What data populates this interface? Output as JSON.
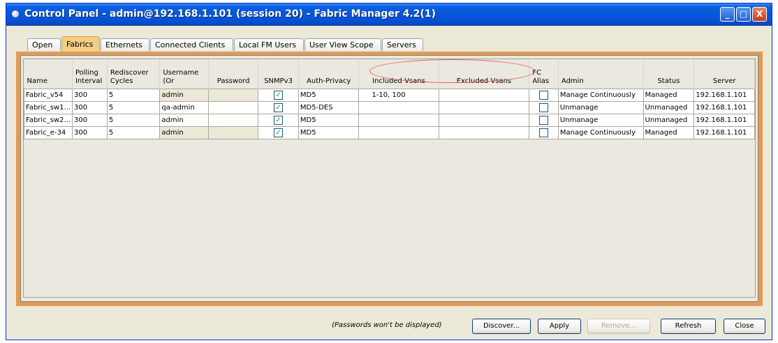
{
  "window": {
    "title": "Control Panel - admin@192.168.1.101 (session 20) - Fabric Manager 4.2(1)",
    "controls": {
      "minimize": "_",
      "maximize": "□",
      "close": "X"
    }
  },
  "tabs": [
    {
      "label": "Open",
      "active": false
    },
    {
      "label": "Fabrics",
      "active": true
    },
    {
      "label": "Ethernets",
      "active": false
    },
    {
      "label": "Connected Clients",
      "active": false
    },
    {
      "label": "Local FM Users",
      "active": false
    },
    {
      "label": "User View Scope",
      "active": false
    },
    {
      "label": "Servers",
      "active": false
    }
  ],
  "table": {
    "headers": [
      {
        "line1": "",
        "line2": "Name"
      },
      {
        "line1": "Polling",
        "line2": "Interval"
      },
      {
        "line1": "Rediscover",
        "line2": "Cycles"
      },
      {
        "line1": "Username",
        "line2": "(Or"
      },
      {
        "line1": "",
        "line2": "Password"
      },
      {
        "line1": "",
        "line2": "SNMPv3"
      },
      {
        "line1": "",
        "line2": "Auth-Privacy"
      },
      {
        "line1": "",
        "line2": "Included Vsans"
      },
      {
        "line1": "",
        "line2": "Excluded Vsans"
      },
      {
        "line1": "FC",
        "line2": "Alias"
      },
      {
        "line1": "",
        "line2": "Admin"
      },
      {
        "line1": "",
        "line2": "Status"
      },
      {
        "line1": "",
        "line2": "Server"
      }
    ],
    "rows": [
      {
        "name": "Fabric_v54",
        "polling": "300",
        "rediscover": "5",
        "username": "admin",
        "password": "",
        "snmpv3": true,
        "auth": "MD5",
        "included": "1-10, 100",
        "excluded": "",
        "fc_alias": false,
        "admin": "Manage Continuously",
        "status": "Managed",
        "server": "192.168.1.101"
      },
      {
        "name": "Fabric_sw1...",
        "polling": "300",
        "rediscover": "5",
        "username": "qa-admin",
        "password": "",
        "snmpv3": true,
        "auth": "MD5-DES",
        "included": "",
        "excluded": "",
        "fc_alias": false,
        "admin": "Unmanage",
        "status": "Unmanaged",
        "server": "192.168.1.101"
      },
      {
        "name": "Fabric_sw2...",
        "polling": "300",
        "rediscover": "5",
        "username": "admin",
        "password": "",
        "snmpv3": true,
        "auth": "MD5",
        "included": "",
        "excluded": "",
        "fc_alias": false,
        "admin": "Unmanage",
        "status": "Unmanaged",
        "server": "192.168.1.101"
      },
      {
        "name": "Fabric_e-34",
        "polling": "300",
        "rediscover": "5",
        "username": "admin",
        "password": "",
        "snmpv3": true,
        "auth": "MD5",
        "included": "",
        "excluded": "",
        "fc_alias": false,
        "admin": "Manage Continuously",
        "status": "Managed",
        "server": "192.168.1.101"
      }
    ]
  },
  "footer": {
    "note": "(Passwords won't be displayed)",
    "buttons": [
      {
        "label": "Discover...",
        "enabled": true
      },
      {
        "label": "Apply",
        "enabled": true
      },
      {
        "label": "Remove...",
        "enabled": false
      },
      {
        "label": "Refresh",
        "enabled": true
      },
      {
        "label": "Close",
        "enabled": true
      }
    ]
  },
  "colors": {
    "titlebar": "#0653d6",
    "active_tab": "#f4cc84",
    "panel_border": "#e39a55",
    "annotation": "#e05a5a",
    "checkmark": "#21a121"
  },
  "icons": {
    "window_icon": "app-dot-icon",
    "checkbox_checked": "checkmark-icon"
  }
}
